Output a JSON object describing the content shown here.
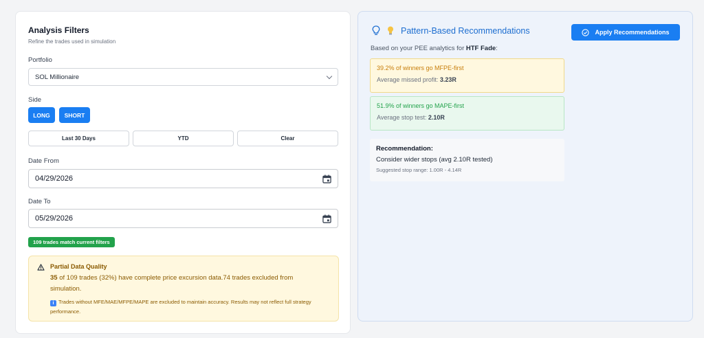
{
  "filters": {
    "title": "Analysis Filters",
    "subtitle": "Refine the trades used in simulation",
    "portfolio_label": "Portfolio",
    "portfolio_value": "SOL Millionaire",
    "side_label": "Side",
    "side_long": "LONG",
    "side_short": "SHORT",
    "range_last30": "Last 30 Days",
    "range_ytd": "YTD",
    "range_clear": "Clear",
    "date_from_label": "Date From",
    "date_from_value": "04/29/2026",
    "date_to_label": "Date To",
    "date_to_value": "05/29/2026",
    "match_badge": "109 trades match current filters"
  },
  "quality": {
    "title": "Partial Data Quality",
    "count_bold": "35",
    "body": " of 109 trades (32%) have complete price excursion data.74 trades excluded from simulation.",
    "note": "Trades without MFE/MAE/MFPE/MAPE are excluded to maintain accuracy. Results may not reflect full strategy performance."
  },
  "recommendations": {
    "title": "Pattern-Based Recommendations",
    "apply_label": "Apply Recommendations",
    "based_prefix": "Based on your PEE analytics for ",
    "pattern_name": "HTF Fade",
    "based_suffix": ":",
    "mfpe_line": "39.2% of winners go MFPE-first",
    "mfpe_sub_prefix": "Average missed profit: ",
    "mfpe_sub_value": "3.23R",
    "mape_line": "51.9% of winners go MAPE-first",
    "mape_sub_prefix": "Average stop test: ",
    "mape_sub_value": "2.10R",
    "rec_label": "Recommendation:",
    "rec_text": "Consider wider stops (avg 2.10R tested)",
    "rec_range": "Suggested stop range: 1.00R - 4.14R"
  },
  "colors": {
    "accent": "#1a7ef2",
    "success": "#22a24b",
    "warning_text": "#8a5a00",
    "mfpe_text": "#c77d0a",
    "mape_text": "#22a24b"
  },
  "icons": [
    "chevron-down-icon",
    "calendar-icon",
    "warning-triangle-icon",
    "info-icon",
    "lightbulb-icon",
    "bulb-emoji-icon",
    "check-circle-icon"
  ]
}
